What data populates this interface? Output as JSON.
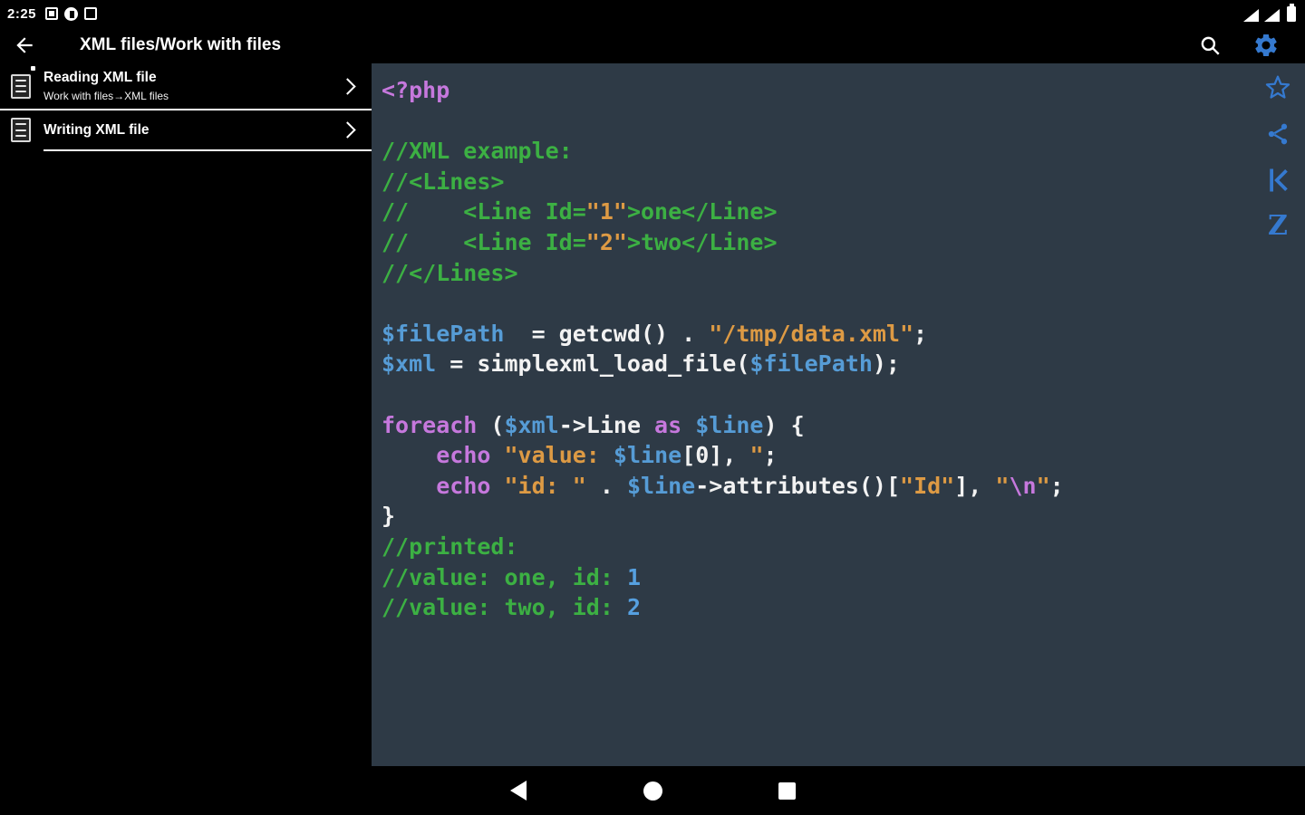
{
  "colors": {
    "code_bg": "#2e3a46",
    "accent_blue": "#3579cf",
    "keyword": "#c678dd",
    "comment": "#3cb043",
    "string": "#dd9a44",
    "variable": "#569cd6",
    "number": "#56a0e0",
    "plain": "#f2f2f2"
  },
  "status_bar": {
    "time": "2:25",
    "left_icons": [
      "notification-square-icon",
      "notification-circle-icon",
      "notification-box-icon"
    ],
    "right_icons": [
      "wifi-icon",
      "cell-signal-icon",
      "battery-icon"
    ]
  },
  "app_bar": {
    "title": "XML files/Work with files",
    "icons": [
      "back-arrow-icon",
      "search-icon",
      "settings-gear-icon"
    ]
  },
  "sidebar": {
    "items": [
      {
        "title": "Reading XML file",
        "subtitle": "Work with files→XML files"
      },
      {
        "title": "Writing XML file",
        "subtitle": ""
      }
    ]
  },
  "code": {
    "language": "php",
    "lines": [
      [
        {
          "t": "<?php",
          "c": "k"
        }
      ],
      [],
      [
        {
          "t": "//XML example:",
          "c": "c"
        }
      ],
      [
        {
          "t": "//<Lines>",
          "c": "c"
        }
      ],
      [
        {
          "t": "//    <Line Id=",
          "c": "c"
        },
        {
          "t": "\"1\"",
          "c": "s"
        },
        {
          "t": ">one</Line>",
          "c": "c"
        }
      ],
      [
        {
          "t": "//    <Line Id=",
          "c": "c"
        },
        {
          "t": "\"2\"",
          "c": "s"
        },
        {
          "t": ">two</Line>",
          "c": "c"
        }
      ],
      [
        {
          "t": "//</Lines>",
          "c": "c"
        }
      ],
      [],
      [
        {
          "t": "$filePath",
          "c": "v"
        },
        {
          "t": "  = getcwd() . ",
          "c": "p"
        },
        {
          "t": "\"/tmp/data.xml\"",
          "c": "s"
        },
        {
          "t": ";",
          "c": "p"
        }
      ],
      [
        {
          "t": "$xml",
          "c": "v"
        },
        {
          "t": " = simplexml_load_file(",
          "c": "p"
        },
        {
          "t": "$filePath",
          "c": "v"
        },
        {
          "t": ");",
          "c": "p"
        }
      ],
      [],
      [
        {
          "t": "foreach",
          "c": "k"
        },
        {
          "t": " (",
          "c": "p"
        },
        {
          "t": "$xml",
          "c": "v"
        },
        {
          "t": "->Line ",
          "c": "p"
        },
        {
          "t": "as",
          "c": "k"
        },
        {
          "t": " ",
          "c": "p"
        },
        {
          "t": "$line",
          "c": "v"
        },
        {
          "t": ") {",
          "c": "p"
        }
      ],
      [
        {
          "t": "    ",
          "c": "p"
        },
        {
          "t": "echo",
          "c": "k"
        },
        {
          "t": " ",
          "c": "p"
        },
        {
          "t": "\"value: ",
          "c": "s"
        },
        {
          "t": "$line",
          "c": "v"
        },
        {
          "t": "[0], ",
          "c": "p"
        },
        {
          "t": "\"",
          "c": "s"
        },
        {
          "t": ";",
          "c": "p"
        }
      ],
      [
        {
          "t": "    ",
          "c": "p"
        },
        {
          "t": "echo",
          "c": "k"
        },
        {
          "t": " ",
          "c": "p"
        },
        {
          "t": "\"id: \"",
          "c": "s"
        },
        {
          "t": " . ",
          "c": "p"
        },
        {
          "t": "$line",
          "c": "v"
        },
        {
          "t": "->attributes()[",
          "c": "p"
        },
        {
          "t": "\"Id\"",
          "c": "s"
        },
        {
          "t": "], ",
          "c": "p"
        },
        {
          "t": "\"",
          "c": "s"
        },
        {
          "t": "\\n",
          "c": "k"
        },
        {
          "t": "\"",
          "c": "s"
        },
        {
          "t": ";",
          "c": "p"
        }
      ],
      [
        {
          "t": "}",
          "c": "p"
        }
      ],
      [
        {
          "t": "//printed:",
          "c": "c"
        }
      ],
      [
        {
          "t": "//value: one, id: ",
          "c": "c"
        },
        {
          "t": "1",
          "c": "n"
        }
      ],
      [
        {
          "t": "//value: two, id: ",
          "c": "c"
        },
        {
          "t": "2",
          "c": "n"
        }
      ]
    ]
  },
  "right_toolbar": {
    "icons": [
      "favorite-star-icon",
      "share-icon",
      "skip-to-start-icon",
      "letter-z-icon"
    ],
    "z_label": "Z"
  },
  "bottom_nav": {
    "icons": [
      "nav-back-icon",
      "nav-home-icon",
      "nav-recents-icon"
    ]
  }
}
